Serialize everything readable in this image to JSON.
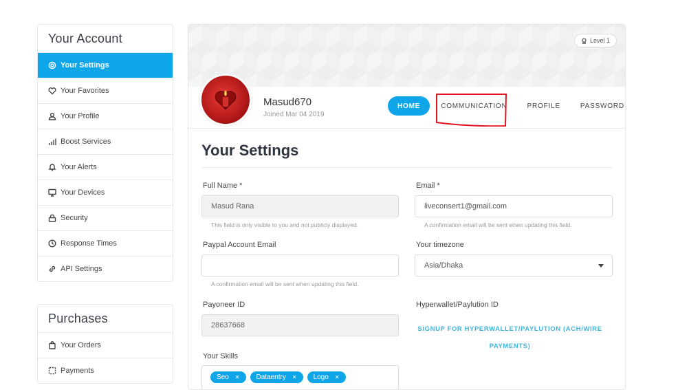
{
  "account_menu": {
    "title": "Your Account",
    "items": [
      {
        "label": "Your Settings",
        "icon": "gear-icon",
        "active": true
      },
      {
        "label": "Your Favorites",
        "icon": "heart-icon"
      },
      {
        "label": "Your Profile",
        "icon": "user-icon"
      },
      {
        "label": "Boost Services",
        "icon": "bar-chart-icon"
      },
      {
        "label": "Your Alerts",
        "icon": "bell-icon"
      },
      {
        "label": "Your Devices",
        "icon": "monitor-icon"
      },
      {
        "label": "Security",
        "icon": "lock-icon"
      },
      {
        "label": "Response Times",
        "icon": "clock-icon"
      },
      {
        "label": "API Settings",
        "icon": "link-icon"
      }
    ]
  },
  "purchases_menu": {
    "title": "Purchases",
    "items": [
      {
        "label": "Your Orders",
        "icon": "bag-icon"
      },
      {
        "label": "Payments",
        "icon": "dashed-square-icon"
      }
    ]
  },
  "profile": {
    "username": "Masud670",
    "joined": "Joined Mar 04 2019",
    "level": "Level 1"
  },
  "tabs": {
    "home": "HOME",
    "communication": "COMMUNICATION",
    "profile": "PROFILE",
    "password": "PASSWORD"
  },
  "settings": {
    "title": "Your Settings",
    "full_name_label": "Full Name *",
    "full_name_value": "Masud Rana",
    "full_name_hint": "This field is only visible to you and not publicly displayed.",
    "email_label": "Email *",
    "email_value": "liveconsert1@gmail.com",
    "email_hint": "A confirmation email will be sent when updating this field.",
    "paypal_label": "Paypal Account Email",
    "paypal_value": "",
    "paypal_hint": "A confirmation email will be sent when updating this field.",
    "timezone_label": "Your timezone",
    "timezone_value": "Asia/Dhaka",
    "payoneer_label": "Payoneer ID",
    "payoneer_value": "28637668",
    "hyperwallet_label": "Hyperwallet/Paylution ID",
    "hyperwallet_link": "SIGNUP FOR HYPERWALLET/PAYLUTION (ACH/WIRE PAYMENTS)",
    "skills_label": "Your Skills",
    "skills": [
      "Seo",
      "Dataentry",
      "Logo"
    ]
  },
  "colors": {
    "accent": "#0ea5e9",
    "link": "#3fb6dc",
    "annotation": "#e0141e"
  }
}
